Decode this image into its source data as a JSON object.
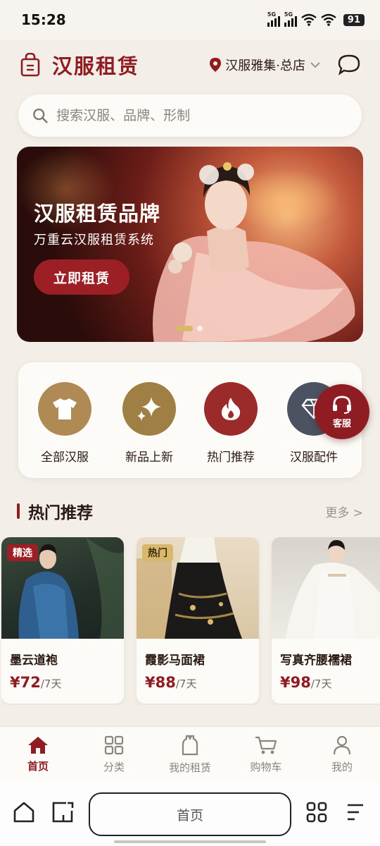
{
  "status_bar": {
    "time": "15:28",
    "signal1_label": "5G",
    "signal2_label": "5G",
    "battery": "91"
  },
  "header": {
    "title": "汉服租赁",
    "store": "汉服雅集·总店"
  },
  "search": {
    "placeholder": "搜索汉服、品牌、形制"
  },
  "banner": {
    "title": "汉服租赁品牌",
    "subtitle": "万重云汉服租赁系统",
    "cta": "立即租赁"
  },
  "categories": [
    {
      "label": "全部汉服",
      "color": "#b08a55"
    },
    {
      "label": "新品上新",
      "color": "#a07f45"
    },
    {
      "label": "热门推荐",
      "color": "#9b2b2b"
    },
    {
      "label": "汉服配件",
      "color": "#4b5262"
    }
  ],
  "customer_service": {
    "label": "客服"
  },
  "hot_section": {
    "title": "热门推荐",
    "more": "更多 >"
  },
  "products": [
    {
      "badge": "精选",
      "name": "墨云道袍",
      "price": "¥72",
      "period": "/7天"
    },
    {
      "badge": "热门",
      "name": "霞影马面裙",
      "price": "¥88",
      "period": "/7天"
    },
    {
      "badge": "",
      "name": "写真齐腰襦裙",
      "price": "¥98",
      "period": "/7天"
    }
  ],
  "tabbar": [
    {
      "label": "首页",
      "icon": "home-icon"
    },
    {
      "label": "分类",
      "icon": "grid-icon"
    },
    {
      "label": "我的租赁",
      "icon": "garment-icon"
    },
    {
      "label": "购物车",
      "icon": "cart-icon"
    },
    {
      "label": "我的",
      "icon": "user-icon"
    }
  ],
  "browser": {
    "address": "首页"
  },
  "colors": {
    "brand": "#8e1c22",
    "background": "#f3efe8",
    "gold": "#d8b86a"
  }
}
